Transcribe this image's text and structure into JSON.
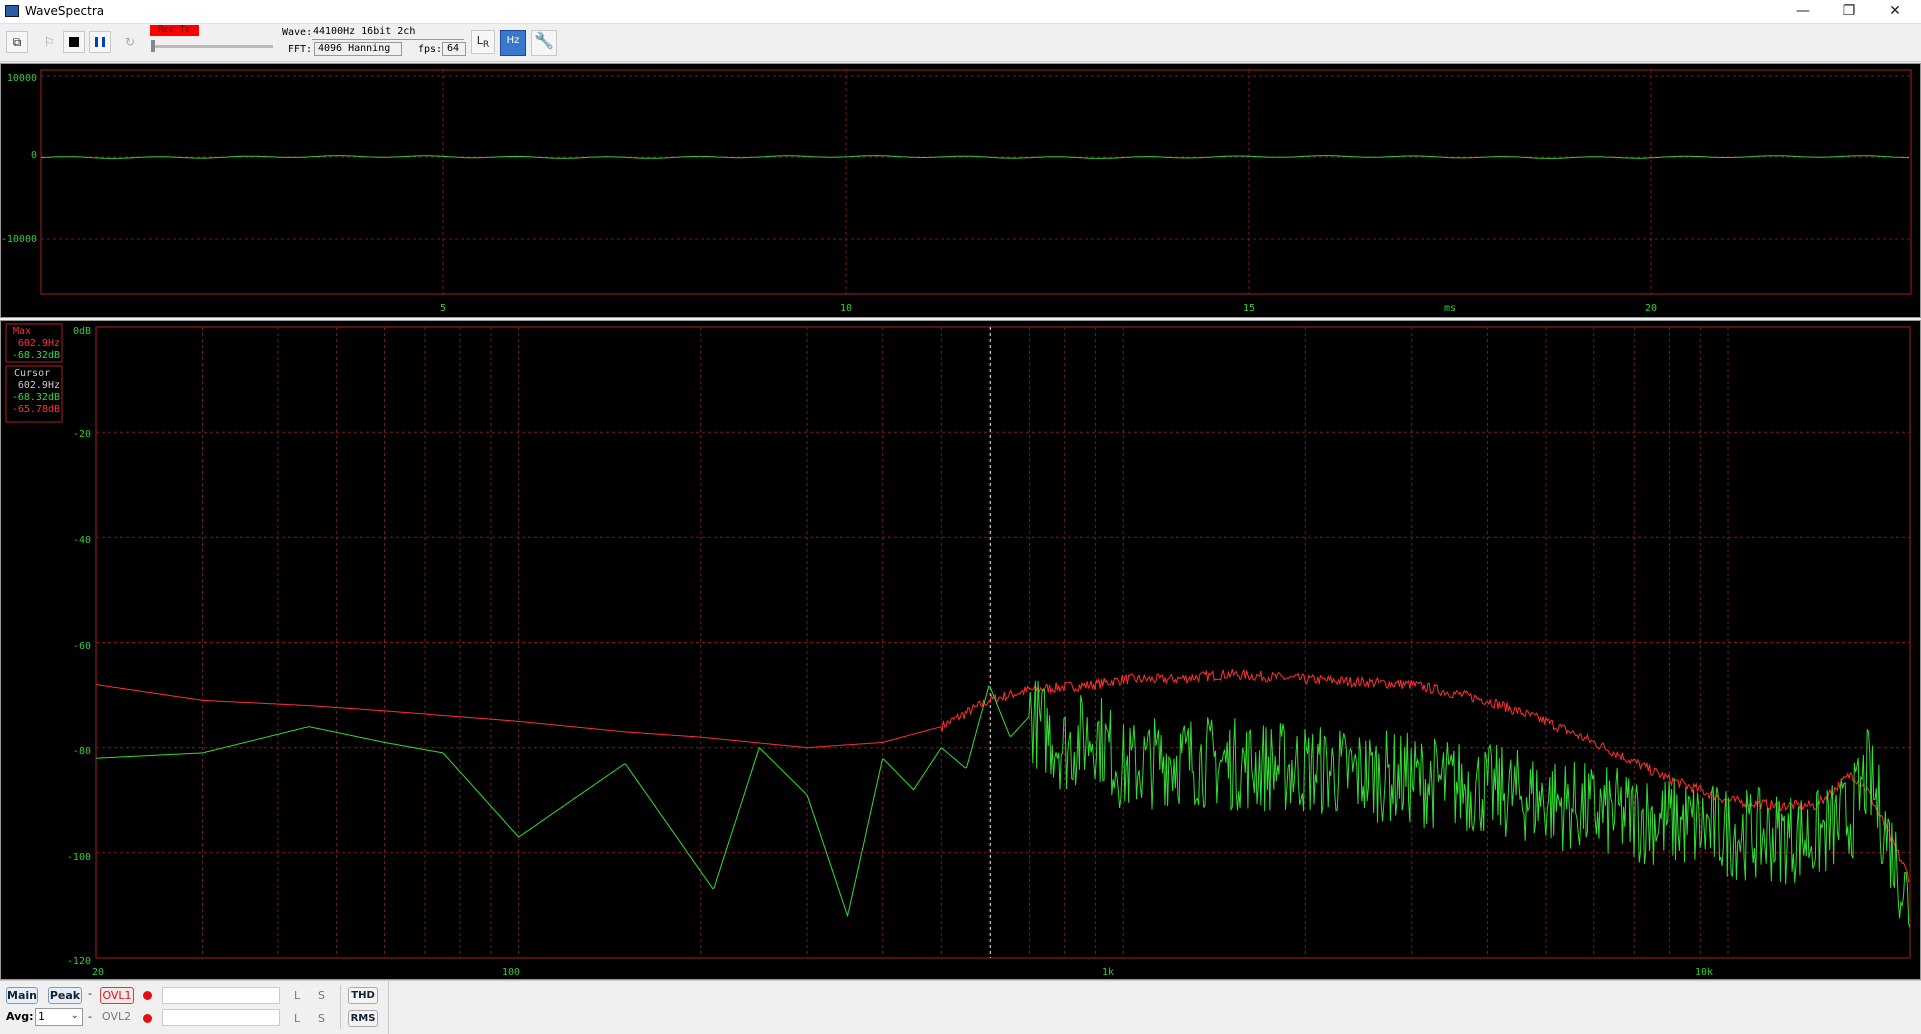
{
  "window": {
    "title": "WaveSpectra",
    "minimize_glyph": "—",
    "restore_glyph": "❐",
    "close_glyph": "✕"
  },
  "toolbar": {
    "rec_label": "Rec To",
    "wave_label": "Wave:",
    "wave_value": "44100Hz 16bit 2ch",
    "fft_label": "FFT:",
    "fft_value": "4096 Hanning",
    "fps_label": "fps:",
    "fps_value": "64",
    "buttons": [
      "device-icon",
      "play-icon",
      "stop-icon",
      "pause-icon",
      "loop-icon",
      "lr-icon",
      "hz-scale-icon",
      "settings-wrench-icon"
    ]
  },
  "scope": {
    "y_ticks": [
      "10000",
      "0",
      "-10000"
    ],
    "x_ticks": [
      "5",
      "10",
      "15",
      "20"
    ],
    "unit": "ms"
  },
  "spectrum": {
    "y_ticks": [
      "0dB",
      "-20",
      "-40",
      "-60",
      "-80",
      "-100",
      "-120"
    ],
    "x_ticks": [
      "20",
      "100",
      "1k",
      "10k"
    ],
    "max_box": {
      "title": "Max",
      "freq": "602.9Hz",
      "level": "-68.32dB"
    },
    "cursor_box": {
      "title": "Cursor",
      "freq": "602.9Hz",
      "level_l": "-68.32dB",
      "level_r": "-65.78dB"
    }
  },
  "chart_data": {
    "type": "line",
    "title": "",
    "xlabel": "",
    "ylabel": "",
    "x_scale": "log",
    "xlim": [
      20,
      20000
    ],
    "ylim": [
      -120,
      0
    ],
    "grid": true,
    "cursor_x": 602.9,
    "series": [
      {
        "color": "#ff3030",
        "x": [
          20,
          30,
          45,
          60,
          100,
          150,
          200,
          300,
          400,
          500,
          600,
          700,
          900,
          1000,
          1200,
          1500,
          2000,
          3000,
          4000,
          5000,
          6000,
          8000,
          10000,
          12000,
          14000,
          16000,
          17000,
          20000
        ],
        "y": [
          -68,
          -71,
          -72,
          -73,
          -75,
          -77,
          -78,
          -80,
          -79,
          -76,
          -71,
          -69,
          -68,
          -67,
          -67,
          -66,
          -67,
          -68,
          -71,
          -75,
          -79,
          -86,
          -90,
          -91,
          -91,
          -85,
          -88,
          -105
        ]
      },
      {
        "color": "#33dd33",
        "x": [
          20,
          30,
          45,
          60,
          75,
          100,
          150,
          210,
          250,
          300,
          350,
          400,
          450,
          500,
          550,
          600,
          650,
          700,
          800,
          900,
          1000,
          1200,
          1500,
          2000,
          2500,
          3000,
          4000,
          5000,
          6000,
          8000,
          10000,
          12000,
          14000,
          16000,
          17000,
          20000
        ],
        "y": [
          -82,
          -81,
          -76,
          -79,
          -81,
          -97,
          -83,
          -107,
          -80,
          -89,
          -112,
          -82,
          -88,
          -80,
          -84,
          -68,
          -78,
          -74,
          -80,
          -77,
          -84,
          -82,
          -83,
          -84,
          -85,
          -86,
          -88,
          -90,
          -92,
          -94,
          -96,
          -97,
          -97,
          -93,
          -85,
          -110
        ]
      }
    ]
  },
  "bottom": {
    "main_label": "Main",
    "peak_label": "Peak",
    "dash1": "-",
    "ovl1_label": "OVL1",
    "avg_label": "Avg:",
    "avg_value": "1",
    "dash2": "-",
    "ovl2_label": "OVL2",
    "l_label": "L",
    "s_label": "S",
    "thd_label": "THD",
    "rms_label": "RMS"
  }
}
